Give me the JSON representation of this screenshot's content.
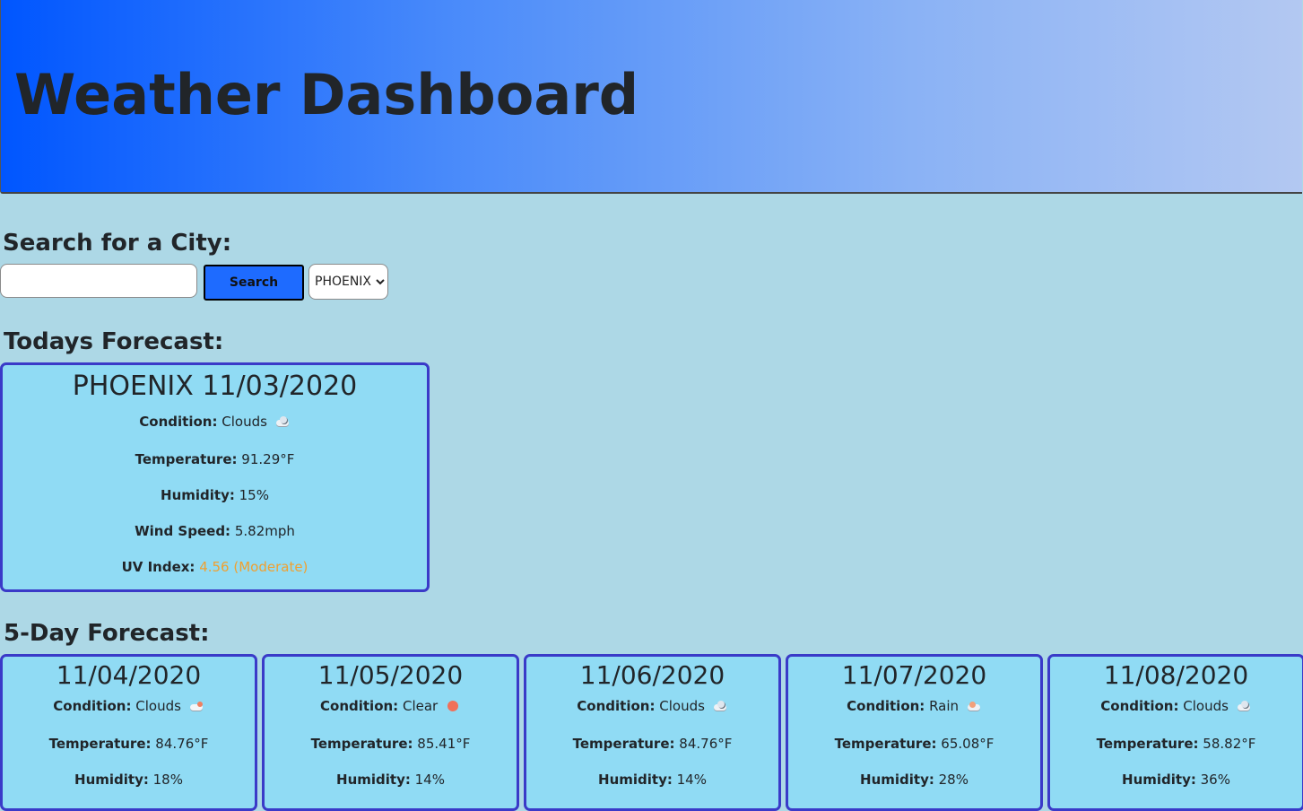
{
  "header": {
    "title": "Weather Dashboard"
  },
  "search": {
    "heading": "Search for a City:",
    "input_value": "",
    "input_placeholder": "",
    "button_label": "Search",
    "selected_city": "PHOENIX"
  },
  "today": {
    "heading": "Todays Forecast:",
    "title": "PHOENIX 11/03/2020",
    "condition_label": "Condition:",
    "condition": "Clouds",
    "condition_icon": "clouds-icon",
    "temperature_label": "Temperature:",
    "temperature": "91.29°F",
    "humidity_label": "Humidity:",
    "humidity": "15%",
    "wind_label": "Wind Speed:",
    "wind": "5.82mph",
    "uv_label": "UV Index:",
    "uv": "4.56 (Moderate)",
    "uv_color": "#f0a030"
  },
  "forecast": {
    "heading": "5-Day Forecast:",
    "days": [
      {
        "date": "11/04/2020",
        "condition_label": "Condition:",
        "condition": "Clouds",
        "icon": "clouds-sun-icon",
        "temperature_label": "Temperature:",
        "temperature": "84.76°F",
        "humidity_label": "Humidity:",
        "humidity": "18%"
      },
      {
        "date": "11/05/2020",
        "condition_label": "Condition:",
        "condition": "Clear",
        "icon": "sun-icon",
        "temperature_label": "Temperature:",
        "temperature": "85.41°F",
        "humidity_label": "Humidity:",
        "humidity": "14%"
      },
      {
        "date": "11/06/2020",
        "condition_label": "Condition:",
        "condition": "Clouds",
        "icon": "clouds-icon",
        "temperature_label": "Temperature:",
        "temperature": "84.76°F",
        "humidity_label": "Humidity:",
        "humidity": "14%"
      },
      {
        "date": "11/07/2020",
        "condition_label": "Condition:",
        "condition": "Rain",
        "icon": "rain-icon",
        "temperature_label": "Temperature:",
        "temperature": "65.08°F",
        "humidity_label": "Humidity:",
        "humidity": "28%"
      },
      {
        "date": "11/08/2020",
        "condition_label": "Condition:",
        "condition": "Clouds",
        "icon": "clouds-icon",
        "temperature_label": "Temperature:",
        "temperature": "58.82°F",
        "humidity_label": "Humidity:",
        "humidity": "36%"
      }
    ]
  }
}
